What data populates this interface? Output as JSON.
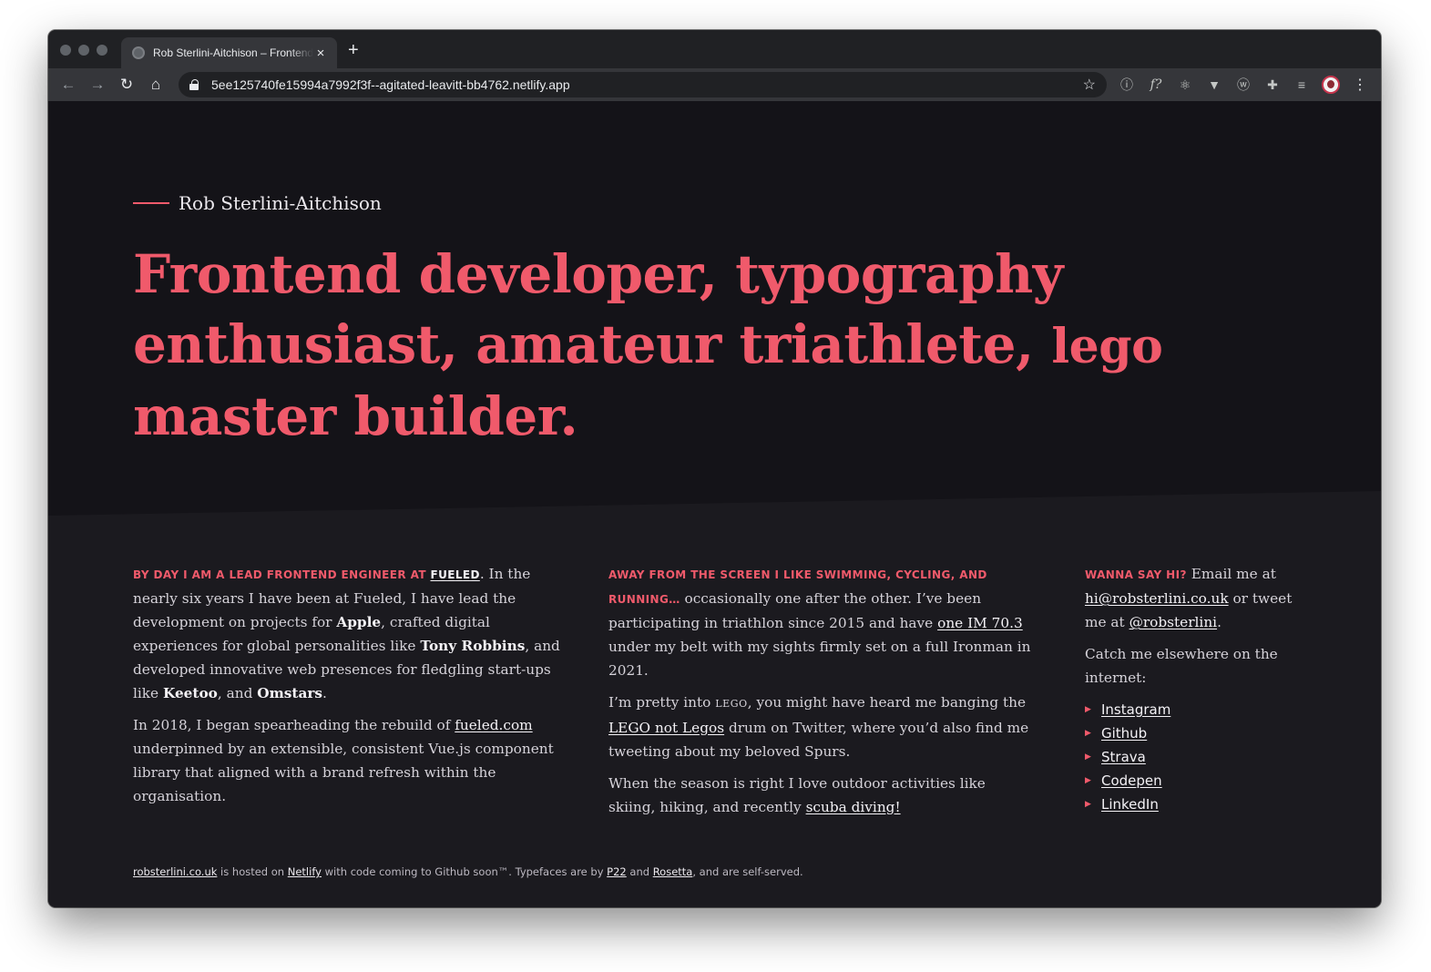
{
  "browser": {
    "tab_title": "Rob Sterlini-Aitchison – Frontend developer",
    "tab_close": "×",
    "new_tab": "+",
    "url": "5ee125740fe15994a7992f3f--agitated-leavitt-bb4762.netlify.app",
    "nav": {
      "back": "←",
      "forward": "→",
      "reload": "↻",
      "home": "⌂"
    },
    "star": "☆",
    "extensions": [
      "ⓘ",
      "f?",
      "⚛",
      "▼",
      "ⓦ",
      "✚",
      "≡"
    ],
    "menu": "⋮"
  },
  "hero": {
    "name": "Rob Sterlini-Aitchison",
    "title_main": "Frontend developer, typography enthusiast, amateur triathlete,",
    "title_lego": "lego",
    "title_end": "master builder."
  },
  "col1": {
    "lead_prefix": "BY DAY I AM A LEAD FRONTEND ENGINEER AT",
    "lead_link": "FUELED",
    "p1_a": ". In the nearly six years I have been at Fueled, I have lead the development on projects for ",
    "apple": "Apple",
    "p1_b": ", crafted digital experiences for global personalities like ",
    "tony": "Tony Robbins",
    "p1_c": ", and developed innovative web presences for fledgling start-ups like ",
    "keetoo": "Keetoo",
    "p1_d": ", and ",
    "omstars": "Omstars",
    "p1_e": ".",
    "p2_a": "In 2018, I began spearheading the rebuild of ",
    "p2_link": "fueled.com",
    "p2_b": " underpinned by an extensible, consistent Vue.js component library that aligned with a brand refresh within the organisation."
  },
  "col2": {
    "lead": "AWAY FROM THE SCREEN I LIKE SWIMMING, CYCLING, AND RUNNING…",
    "p1_a": " occasionally one after the other. I’ve been participating in triathlon since 2015 and have ",
    "p1_link": "one IM 70.3",
    "p1_b": " under my belt with my sights firmly set on a full Ironman in 2021.",
    "p2_a": "I’m pretty into ",
    "p2_lego": "LEGO",
    "p2_b": ", you might have heard me banging the ",
    "p2_link": "LEGO not Legos",
    "p2_c": " drum on Twitter, where you’d also find me tweeting about my beloved Spurs.",
    "p3_a": "When the season is right I love outdoor activities like skiing, hiking, and recently ",
    "p3_link": "scuba diving!"
  },
  "col3": {
    "lead": "WANNA SAY HI?",
    "p1_a": " Email me at ",
    "email": "hi@robsterlini.co.uk",
    "p1_b": " or tweet me at ",
    "twitter": "@robsterlini",
    "p1_c": ".",
    "p2": "Catch me elsewhere on the internet:",
    "links": [
      "Instagram",
      "Github",
      "Strava",
      "Codepen",
      "LinkedIn"
    ],
    "bullet": "▶"
  },
  "footer": {
    "site": "robsterlini.co.uk",
    "t1": " is hosted on ",
    "netlify": "Netlify",
    "t2": " with code coming to Github soon™. Typefaces are by ",
    "p22": "P22",
    "t3": " and ",
    "rosetta": "Rosetta",
    "t4": ", and are self-served."
  },
  "colors": {
    "accent": "#f05a6b",
    "hero_bg": "#141318",
    "body_bg": "#1b1a1f"
  }
}
